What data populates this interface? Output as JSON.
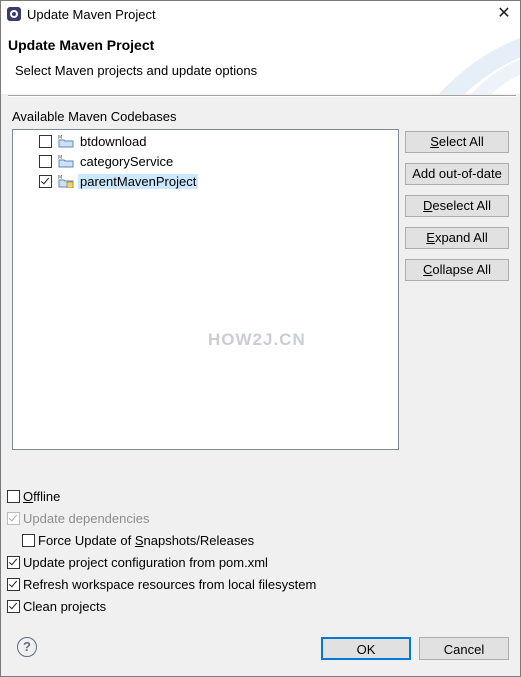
{
  "window": {
    "title": "Update Maven Project"
  },
  "banner": {
    "title": "Update Maven Project",
    "subtitle": "Select Maven projects and update options"
  },
  "codebases": {
    "label": "Available Maven Codebases",
    "items": [
      {
        "label": "btdownload",
        "checked": false,
        "selected": false
      },
      {
        "label": "categoryService",
        "checked": false,
        "selected": false
      },
      {
        "label": "parentMavenProject",
        "checked": true,
        "selected": true
      }
    ],
    "watermark": "HOW2J.CN"
  },
  "side_buttons": {
    "select_all": {
      "mnemonic": "S",
      "rest": "elect All"
    },
    "add_out_of_date": "Add out-of-date",
    "deselect_all": {
      "mnemonic": "D",
      "rest": "eselect All"
    },
    "expand_all": {
      "mnemonic": "E",
      "rest": "xpand All"
    },
    "collapse_all": {
      "mnemonic": "C",
      "rest": "ollapse All"
    }
  },
  "options": {
    "offline": {
      "mnemonic": "O",
      "rest": "ffline",
      "checked": false,
      "enabled": true
    },
    "update_dependencies": {
      "label": "Update dependencies",
      "checked": true,
      "enabled": false
    },
    "force_update": {
      "pre": "Force Update of ",
      "mnemonic": "S",
      "rest": "napshots/Releases",
      "checked": false,
      "enabled": true
    },
    "update_config": {
      "label": "Update project configuration from pom.xml",
      "checked": true,
      "enabled": true
    },
    "refresh_workspace": {
      "label": "Refresh workspace resources from local filesystem",
      "checked": true,
      "enabled": true
    },
    "clean_projects": {
      "label": "Clean projects",
      "checked": true,
      "enabled": true
    }
  },
  "footer": {
    "help_glyph": "?",
    "ok": "OK",
    "cancel": "Cancel"
  },
  "icons": {
    "app": "eclipse-icon",
    "close": "close-icon",
    "project": "maven-project-folder-icon",
    "help": "help-icon"
  },
  "colors": {
    "selection": "#cce8ff",
    "default_button_border": "#0078d7"
  }
}
